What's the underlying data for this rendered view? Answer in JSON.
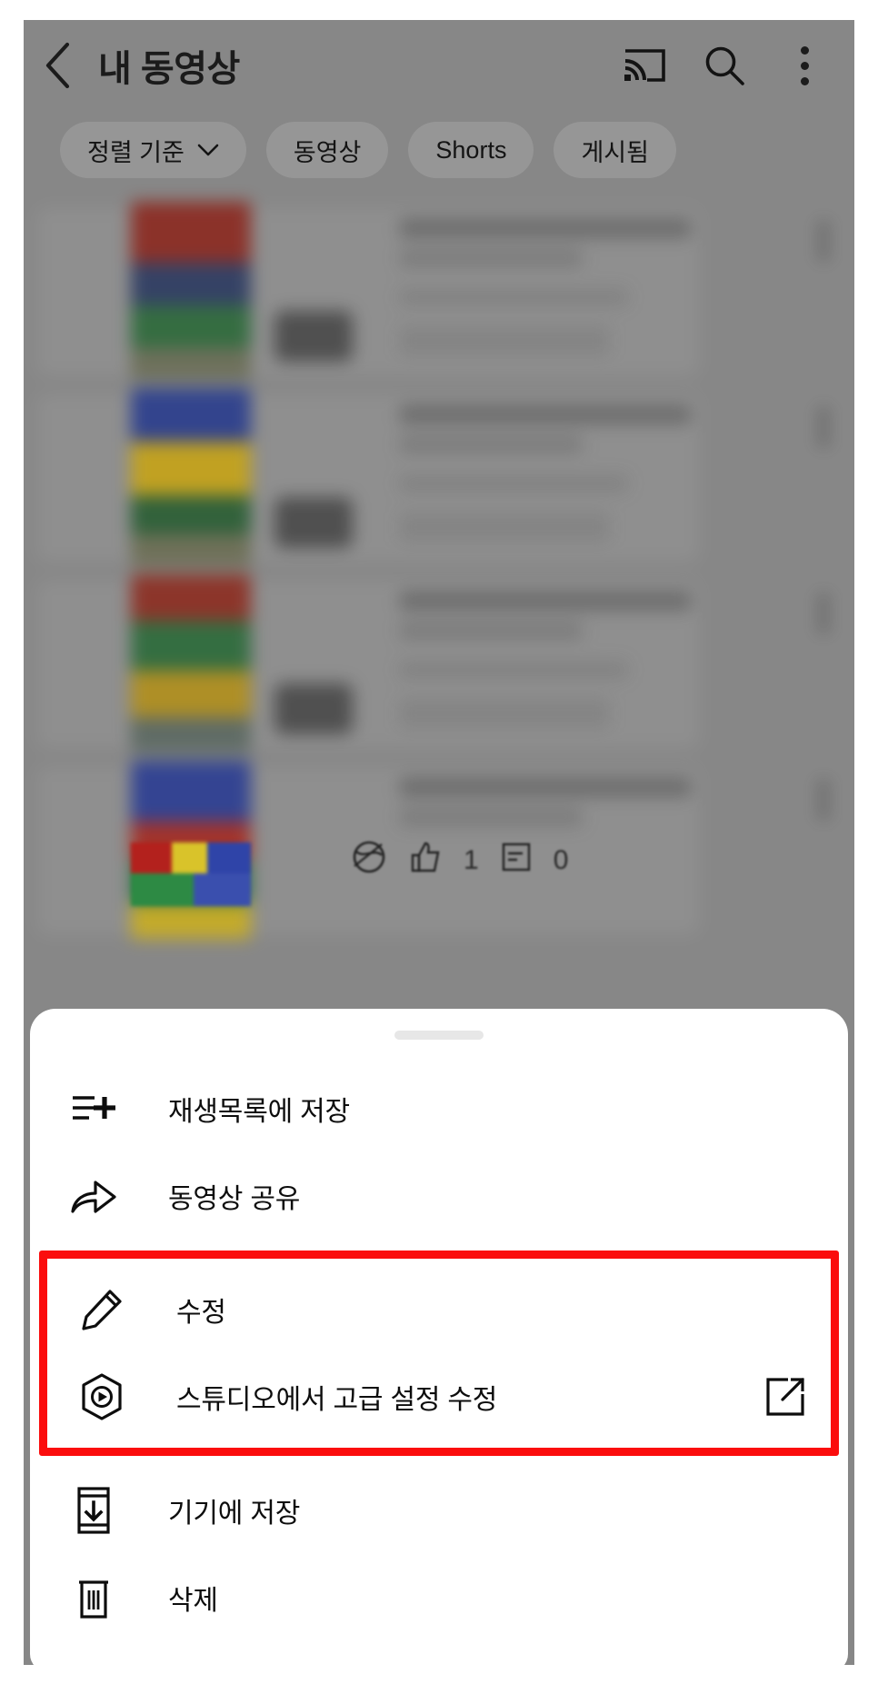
{
  "app": {
    "appbar": {
      "back_icon": "back-chevron-icon",
      "title": "내 동영상",
      "cast_icon": "cast-icon",
      "search_icon": "search-icon",
      "overflow_icon": "kebab-menu-icon"
    },
    "chips": [
      {
        "label": "정렬 기준",
        "has_caret": true
      },
      {
        "label": "동영상",
        "has_caret": false
      },
      {
        "label": "Shorts",
        "has_caret": false
      },
      {
        "label": "게시됨",
        "has_caret": false
      }
    ],
    "last_row_stats": {
      "visibility_icon": "globe-privacy-icon",
      "likes_icon": "thumbs-up-icon",
      "likes": "1",
      "comments_icon": "comment-icon",
      "comments": "0"
    }
  },
  "sheet": {
    "drag_handle": "drag-handle",
    "items": [
      {
        "id": "save-to-playlist",
        "icon": "playlist-add-icon",
        "label": "재생목록에 저장",
        "trailing": null,
        "highlighted": false
      },
      {
        "id": "share-video",
        "icon": "share-arrow-icon",
        "label": "동영상 공유",
        "trailing": null,
        "highlighted": false
      },
      {
        "id": "edit",
        "icon": "pencil-edit-icon",
        "label": "수정",
        "trailing": null,
        "highlighted": true
      },
      {
        "id": "edit-in-studio",
        "icon": "studio-badge-icon",
        "label": "스튜디오에서 고급 설정 수정",
        "trailing": "external-link-icon",
        "highlighted": true
      },
      {
        "id": "save-to-device",
        "icon": "download-device-icon",
        "label": "기기에 저장",
        "trailing": null,
        "highlighted": false
      },
      {
        "id": "delete",
        "icon": "trash-icon",
        "label": "삭제",
        "trailing": null,
        "highlighted": false
      }
    ]
  },
  "colors": {
    "highlight_red": "#fb0d0d",
    "sheet_bg": "#ffffff",
    "scrim": "#878787",
    "text_primary": "#0d0d0d",
    "handle": "#e7e7e7"
  }
}
